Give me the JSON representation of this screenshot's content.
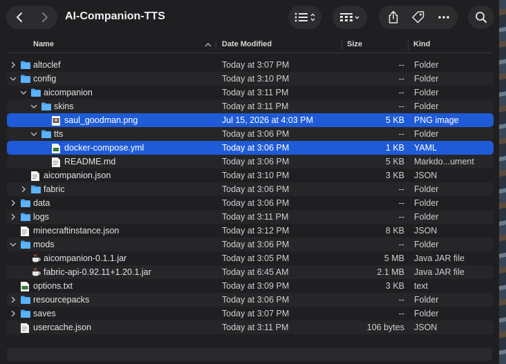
{
  "window": {
    "title": "AI-Companion-TTS"
  },
  "columns": {
    "name": "Name",
    "date": "Date Modified",
    "size": "Size",
    "kind": "Kind"
  },
  "rows": [
    {
      "name": "altoclef",
      "date": "Today at 3:07 PM",
      "size": "--",
      "kind": "Folder",
      "level": 0,
      "disclosure": "collapsed",
      "icon": "folder"
    },
    {
      "name": "config",
      "date": "Today at 3:10 PM",
      "size": "--",
      "kind": "Folder",
      "level": 0,
      "disclosure": "expanded",
      "icon": "folder"
    },
    {
      "name": "aicompanion",
      "date": "Today at 3:11 PM",
      "size": "--",
      "kind": "Folder",
      "level": 1,
      "disclosure": "expanded",
      "icon": "folder"
    },
    {
      "name": "skins",
      "date": "Today at 3:11 PM",
      "size": "--",
      "kind": "Folder",
      "level": 2,
      "disclosure": "expanded",
      "icon": "folder"
    },
    {
      "name": "saul_goodman.png",
      "date": "Jul 15, 2026 at 4:03 PM",
      "size": "5 KB",
      "kind": "PNG image",
      "level": 3,
      "disclosure": "none",
      "icon": "image",
      "selected": true
    },
    {
      "name": "tts",
      "date": "Today at 3:06 PM",
      "size": "--",
      "kind": "Folder",
      "level": 2,
      "disclosure": "expanded",
      "icon": "folder"
    },
    {
      "name": "docker-compose.yml",
      "date": "Today at 3:06 PM",
      "size": "1 KB",
      "kind": "YAML",
      "level": 3,
      "disclosure": "none",
      "icon": "yaml",
      "selected": true
    },
    {
      "name": "README.md",
      "date": "Today at 3:06 PM",
      "size": "5 KB",
      "kind": "Markdo...ument",
      "level": 3,
      "disclosure": "none",
      "icon": "doc"
    },
    {
      "name": "aicompanion.json",
      "date": "Today at 3:10 PM",
      "size": "3 KB",
      "kind": "JSON",
      "level": 1,
      "disclosure": "none",
      "icon": "doc"
    },
    {
      "name": "fabric",
      "date": "Today at 3:06 PM",
      "size": "--",
      "kind": "Folder",
      "level": 1,
      "disclosure": "collapsed",
      "icon": "folder"
    },
    {
      "name": "data",
      "date": "Today at 3:06 PM",
      "size": "--",
      "kind": "Folder",
      "level": 0,
      "disclosure": "collapsed",
      "icon": "folder"
    },
    {
      "name": "logs",
      "date": "Today at 3:11 PM",
      "size": "--",
      "kind": "Folder",
      "level": 0,
      "disclosure": "collapsed",
      "icon": "folder"
    },
    {
      "name": "minecraftinstance.json",
      "date": "Today at 3:12 PM",
      "size": "8 KB",
      "kind": "JSON",
      "level": 0,
      "disclosure": "none",
      "icon": "doc"
    },
    {
      "name": "mods",
      "date": "Today at 3:06 PM",
      "size": "--",
      "kind": "Folder",
      "level": 0,
      "disclosure": "expanded",
      "icon": "folder"
    },
    {
      "name": "aicompanion-0.1.1.jar",
      "date": "Today at 3:05 PM",
      "size": "5 MB",
      "kind": "Java JAR file",
      "level": 1,
      "disclosure": "none",
      "icon": "jar"
    },
    {
      "name": "fabric-api-0.92.11+1.20.1.jar",
      "date": "Today at 6:45 AM",
      "size": "2.1 MB",
      "kind": "Java JAR file",
      "level": 1,
      "disclosure": "none",
      "icon": "jar"
    },
    {
      "name": "options.txt",
      "date": "Today at 3:09 PM",
      "size": "3 KB",
      "kind": "text",
      "level": 0,
      "disclosure": "none",
      "icon": "txt"
    },
    {
      "name": "resourcepacks",
      "date": "Today at 3:06 PM",
      "size": "--",
      "kind": "Folder",
      "level": 0,
      "disclosure": "collapsed",
      "icon": "folder"
    },
    {
      "name": "saves",
      "date": "Today at 3:07 PM",
      "size": "--",
      "kind": "Folder",
      "level": 0,
      "disclosure": "collapsed",
      "icon": "folder"
    },
    {
      "name": "usercache.json",
      "date": "Today at 3:11 PM",
      "size": "106 bytes",
      "kind": "JSON",
      "level": 0,
      "disclosure": "none",
      "icon": "doc"
    }
  ],
  "colors": {
    "selection": "#1f5bd6",
    "folder": "#4aa3f0",
    "background": "#1f1f21"
  }
}
